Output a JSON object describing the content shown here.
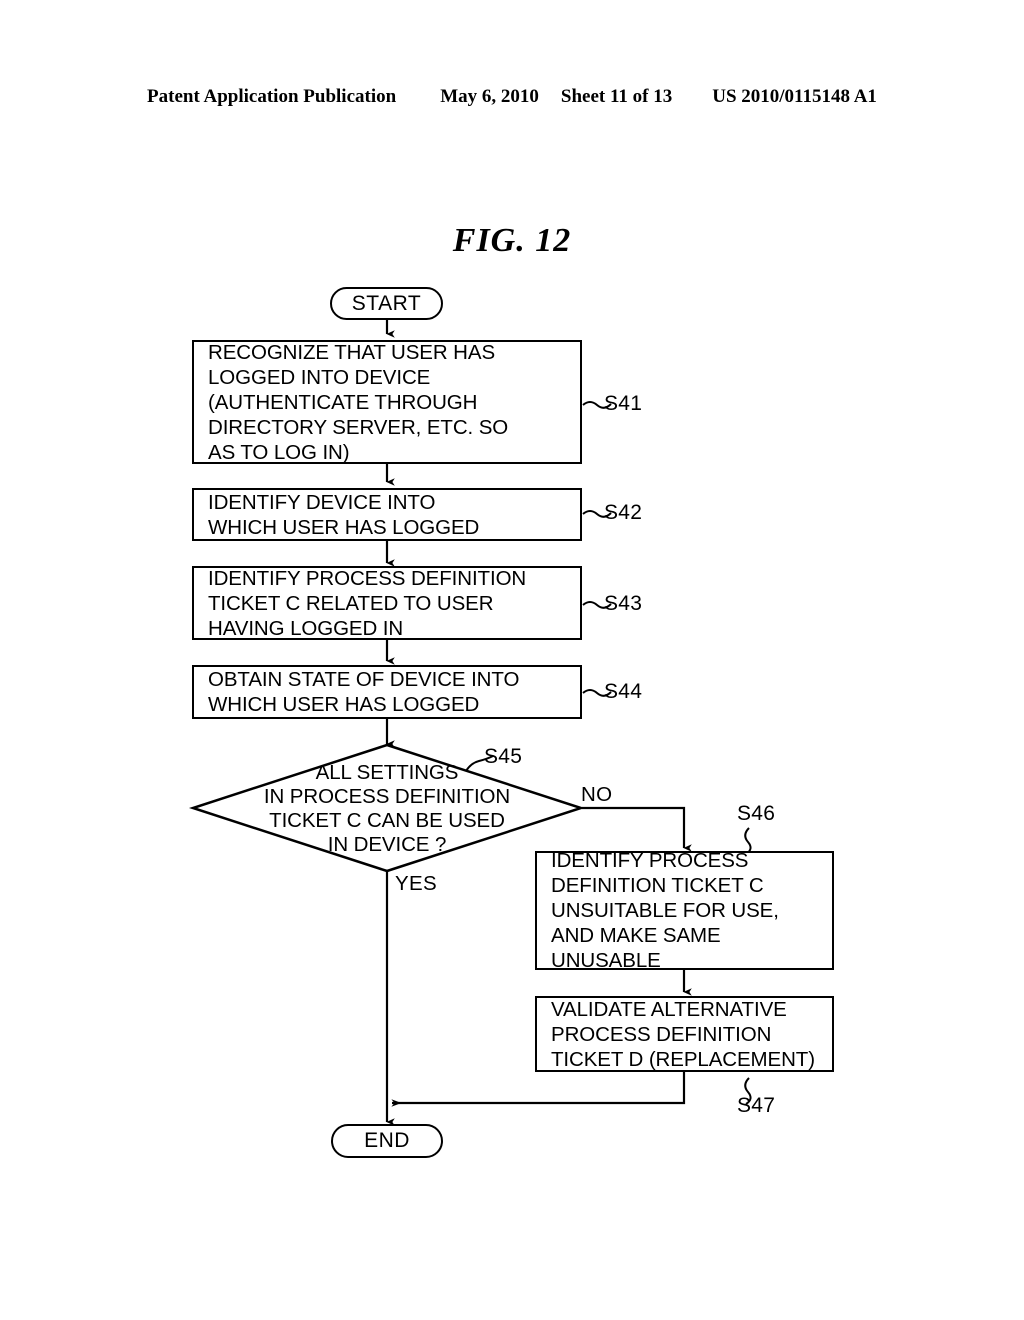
{
  "header": {
    "publication": "Patent Application Publication",
    "date": "May 6, 2010",
    "sheet": "Sheet 11 of 13",
    "patent_number": "US 2010/0115148 A1"
  },
  "figure": {
    "title": "FIG. 12"
  },
  "chart_data": {
    "type": "flowchart",
    "title": "FIG. 12",
    "orientation": "top-to-bottom",
    "nodes": [
      {
        "id": "start",
        "shape": "terminator",
        "label": "START",
        "step": null
      },
      {
        "id": "s41",
        "shape": "process",
        "step": "S41",
        "lines": [
          "RECOGNIZE THAT USER HAS",
          "LOGGED INTO DEVICE",
          "(AUTHENTICATE THROUGH",
          "DIRECTORY SERVER, ETC. SO",
          "AS TO LOG IN)"
        ]
      },
      {
        "id": "s42",
        "shape": "process",
        "step": "S42",
        "lines": [
          "IDENTIFY DEVICE INTO",
          "WHICH USER HAS LOGGED"
        ]
      },
      {
        "id": "s43",
        "shape": "process",
        "step": "S43",
        "lines": [
          "IDENTIFY PROCESS DEFINITION",
          "TICKET C RELATED TO USER",
          "HAVING LOGGED IN"
        ]
      },
      {
        "id": "s44",
        "shape": "process",
        "step": "S44",
        "lines": [
          "OBTAIN STATE OF DEVICE INTO",
          "WHICH USER HAS LOGGED"
        ]
      },
      {
        "id": "s45",
        "shape": "decision",
        "step": "S45",
        "lines": [
          "ALL SETTINGS",
          "IN PROCESS DEFINITION",
          "TICKET C CAN BE USED",
          "IN DEVICE ?"
        ]
      },
      {
        "id": "s46",
        "shape": "process",
        "step": "S46",
        "lines": [
          "IDENTIFY PROCESS",
          "DEFINITION TICKET C",
          "UNSUITABLE FOR USE,",
          "AND MAKE SAME",
          "UNUSABLE"
        ]
      },
      {
        "id": "s47",
        "shape": "process",
        "step": "S47",
        "lines": [
          "VALIDATE ALTERNATIVE",
          "PROCESS DEFINITION",
          "TICKET D (REPLACEMENT)"
        ]
      },
      {
        "id": "end",
        "shape": "terminator",
        "label": "END",
        "step": null
      }
    ],
    "edges": [
      {
        "from": "start",
        "to": "s41",
        "label": ""
      },
      {
        "from": "s41",
        "to": "s42",
        "label": ""
      },
      {
        "from": "s42",
        "to": "s43",
        "label": ""
      },
      {
        "from": "s43",
        "to": "s44",
        "label": ""
      },
      {
        "from": "s44",
        "to": "s45",
        "label": ""
      },
      {
        "from": "s45",
        "to": "end",
        "label": "YES"
      },
      {
        "from": "s45",
        "to": "s46",
        "label": "NO"
      },
      {
        "from": "s46",
        "to": "s47",
        "label": ""
      },
      {
        "from": "s47",
        "to": "end",
        "label": ""
      }
    ],
    "branch_labels": {
      "yes": "YES",
      "no": "NO"
    },
    "step_labels": [
      "S41",
      "S42",
      "S43",
      "S44",
      "S45",
      "S46",
      "S47"
    ],
    "colors": {
      "stroke": "#000000",
      "background": "#ffffff"
    }
  }
}
